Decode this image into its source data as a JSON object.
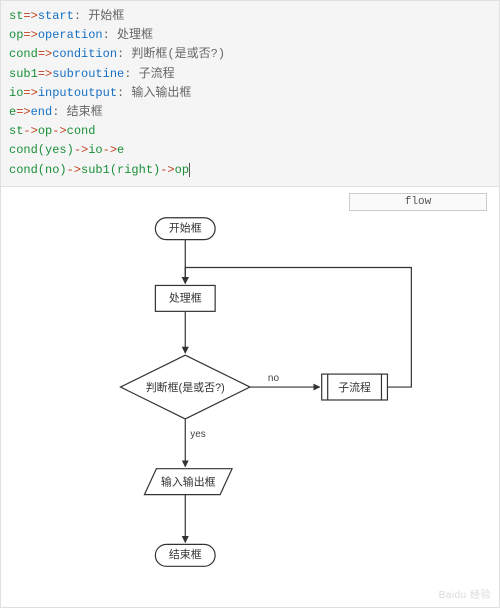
{
  "code_lines": [
    {
      "var": "st",
      "type": "start",
      "label": "开始框"
    },
    {
      "var": "op",
      "type": "operation",
      "label": "处理框"
    },
    {
      "var": "cond",
      "type": "condition",
      "label": "判断框(是或否?)"
    },
    {
      "var": "sub1",
      "type": "subroutine",
      "label": "子流程"
    },
    {
      "var": "io",
      "type": "inputoutput",
      "label": "输入输出框"
    },
    {
      "var": "e",
      "type": "end",
      "label": "结束框"
    }
  ],
  "flow_lines": [
    [
      "st",
      "op",
      "cond"
    ],
    [
      "cond(yes)",
      "io",
      "e"
    ],
    [
      "cond(no)",
      "sub1(right)",
      "op"
    ]
  ],
  "button_label": "flow",
  "chart_data": {
    "type": "flowchart",
    "nodes": {
      "st": {
        "kind": "terminator",
        "label": "开始框"
      },
      "op": {
        "kind": "process",
        "label": "处理框"
      },
      "cond": {
        "kind": "decision",
        "label": "判断框(是或否?)"
      },
      "sub1": {
        "kind": "subroutine",
        "label": "子流程"
      },
      "io": {
        "kind": "io",
        "label": "输入输出框"
      },
      "e": {
        "kind": "terminator",
        "label": "结束框"
      }
    },
    "edges": [
      {
        "from": "st",
        "to": "op"
      },
      {
        "from": "op",
        "to": "cond"
      },
      {
        "from": "cond",
        "to": "io",
        "label": "yes"
      },
      {
        "from": "io",
        "to": "e"
      },
      {
        "from": "cond",
        "to": "sub1",
        "label": "no"
      },
      {
        "from": "sub1",
        "to": "op"
      }
    ]
  },
  "watermark": "Baidu 经验"
}
